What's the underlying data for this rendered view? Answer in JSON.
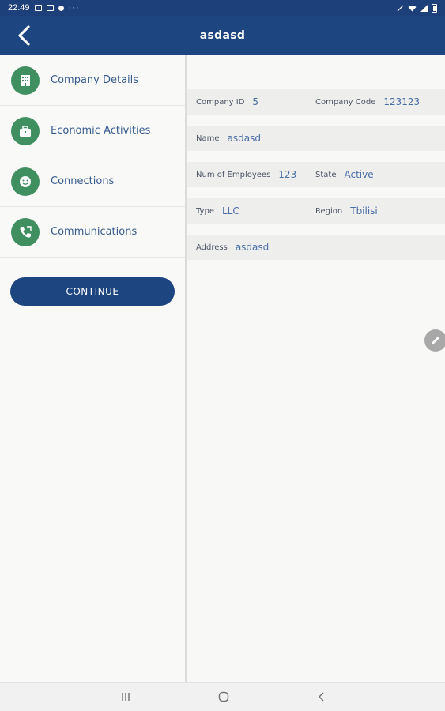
{
  "status_bar": {
    "time": "22:49",
    "more": "···"
  },
  "app_bar": {
    "title": "asdasd"
  },
  "sidebar": {
    "items": [
      {
        "label": "Company Details",
        "icon": "building-icon"
      },
      {
        "label": "Economic Activities",
        "icon": "briefcase-icon"
      },
      {
        "label": "Connections",
        "icon": "smiley-icon"
      },
      {
        "label": "Communications",
        "icon": "phone-icon"
      }
    ],
    "continue_label": "CONTINUE"
  },
  "details": {
    "company_id_label": "Company ID",
    "company_id": "5",
    "company_code_label": "Company Code",
    "company_code": "123123",
    "name_label": "Name",
    "name": "asdasd",
    "employees_label": "Num of Employees",
    "employees": "123",
    "state_label": "State",
    "state": "Active",
    "type_label": "Type",
    "type": "LLC",
    "region_label": "Region",
    "region": "Tbilisi",
    "address_label": "Address",
    "address": "asdasd"
  },
  "colors": {
    "primary": "#1d4580",
    "icon_green": "#3f8f61",
    "value_blue": "#4a6ea6"
  }
}
